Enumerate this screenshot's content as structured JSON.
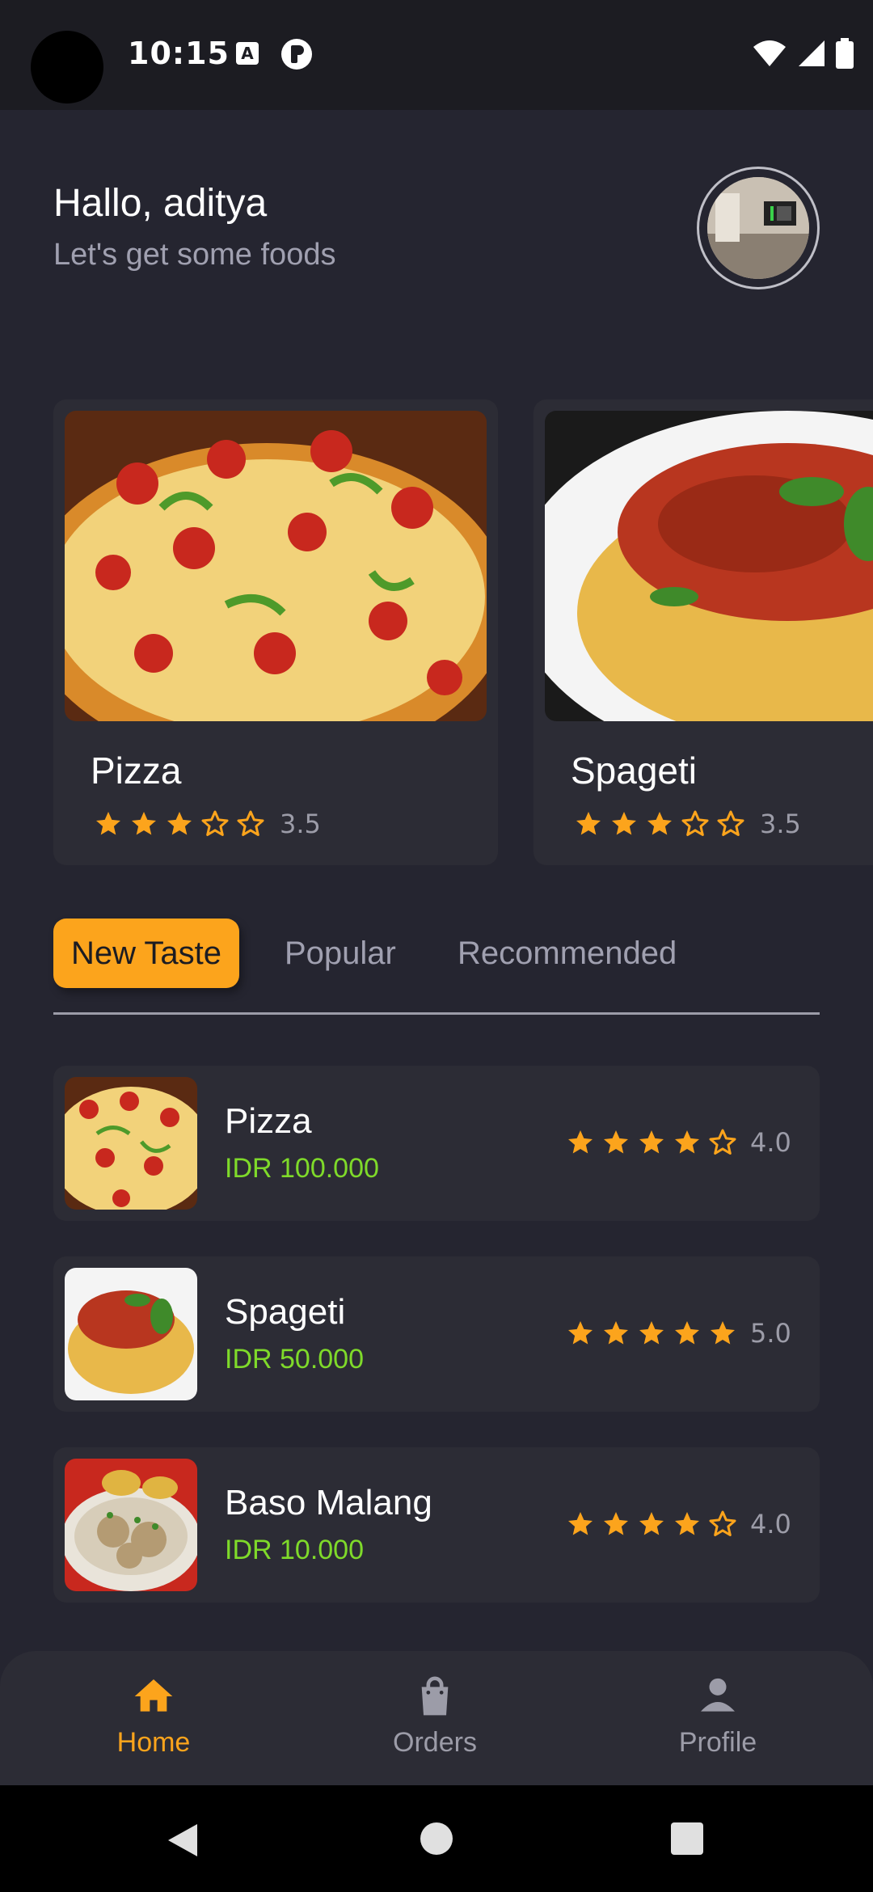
{
  "status_bar": {
    "time": "10:15",
    "icon_a": "A"
  },
  "header": {
    "greeting": "Hallo, aditya",
    "subtitle": "Let's get some foods"
  },
  "featured": [
    {
      "name": "Pizza",
      "rating": "3.5",
      "stars": 3.5
    },
    {
      "name": "Spageti",
      "rating": "3.5",
      "stars": 3.5
    }
  ],
  "tabs": [
    {
      "label": "New Taste",
      "active": true
    },
    {
      "label": "Popular",
      "active": false
    },
    {
      "label": "Recommended",
      "active": false
    }
  ],
  "list": [
    {
      "title": "Pizza",
      "price": "IDR 100.000",
      "rating": "4.0",
      "stars": 4
    },
    {
      "title": "Spageti",
      "price": "IDR 50.000",
      "rating": "5.0",
      "stars": 5
    },
    {
      "title": "Baso Malang",
      "price": "IDR 10.000",
      "rating": "4.0",
      "stars": 4
    }
  ],
  "bottom_nav": [
    {
      "label": "Home",
      "icon": "home-icon",
      "active": true
    },
    {
      "label": "Orders",
      "icon": "bag-icon",
      "active": false
    },
    {
      "label": "Profile",
      "icon": "person-icon",
      "active": false
    }
  ],
  "colors": {
    "accent": "#fca41c",
    "price": "#7fda2a",
    "card": "#2c2c35",
    "background": "#252530"
  }
}
